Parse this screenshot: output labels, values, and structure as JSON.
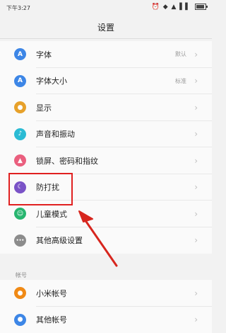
{
  "status": {
    "time": "下午3:27",
    "icons": "⏰ ◆ ▲ ▌▌"
  },
  "header": {
    "title": "设置"
  },
  "settings": [
    {
      "label": "字体",
      "value": "默认",
      "icon": "font-icon",
      "glyph": "A",
      "color": "#3d86e6"
    },
    {
      "label": "字体大小",
      "value": "标准",
      "icon": "font-size-icon",
      "glyph": "A",
      "color": "#3d86e6"
    },
    {
      "label": "显示",
      "value": "",
      "icon": "display-icon",
      "glyph": "●",
      "color": "#e7a12a"
    },
    {
      "label": "声音和振动",
      "value": "",
      "icon": "sound-icon",
      "glyph": "♪",
      "color": "#2bbbd4"
    },
    {
      "label": "锁屏、密码和指纹",
      "value": "",
      "icon": "lock-icon",
      "glyph": "▲",
      "color": "#ea5f7e"
    },
    {
      "label": "防打扰",
      "value": "",
      "icon": "do-not-disturb-icon",
      "glyph": "☾",
      "color": "#7a53c7"
    },
    {
      "label": "儿童模式",
      "value": "",
      "icon": "child-mode-icon",
      "glyph": "☺",
      "color": "#27b56f"
    },
    {
      "label": "其他高级设置",
      "value": "",
      "icon": "more-icon",
      "glyph": "•••",
      "color": "#8c8c8c"
    }
  ],
  "accounts_section": {
    "label": "帐号",
    "items": [
      {
        "label": "小米帐号",
        "icon": "mi-account-icon",
        "glyph": "●",
        "color": "#f08a16"
      },
      {
        "label": "其他帐号",
        "icon": "other-account-icon",
        "glyph": "●",
        "color": "#3d86e6"
      }
    ]
  },
  "chevron": "›"
}
